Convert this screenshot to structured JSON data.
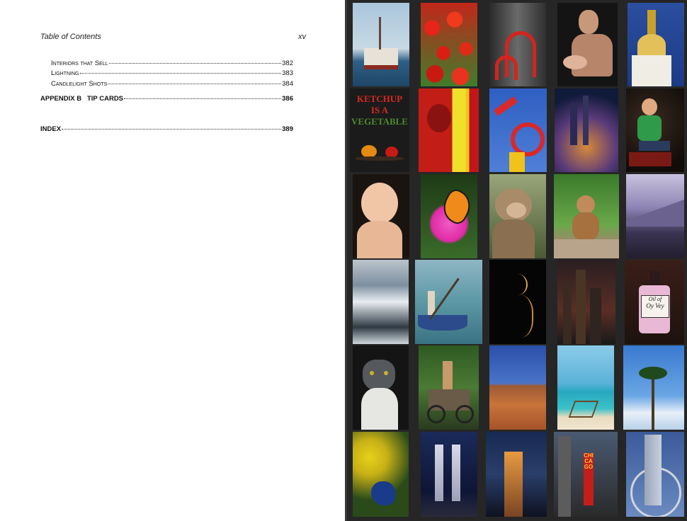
{
  "toc": {
    "header_title": "Table of Contents",
    "header_page": "xv",
    "entries": [
      {
        "label": "Interiors that Sell",
        "page": "382"
      },
      {
        "label": "Lightning",
        "page": "383"
      },
      {
        "label": "Candlelight Shots",
        "page": "384"
      },
      {
        "label": "APPENDIX B   TIP CARDS",
        "page": "386"
      },
      {
        "label": "INDEX",
        "page": "389"
      }
    ]
  },
  "gallery": {
    "ketchup_line1": "KETCHUP",
    "ketchup_line2": "IS A",
    "ketchup_line3": "VEGETABLE",
    "bottle_label_line1": "Oil of",
    "bottle_label_line2": "Oy Vey",
    "sign_text": "CHICAGO",
    "tiles": [
      {
        "subject": "boat-harbor"
      },
      {
        "subject": "red-tulips"
      },
      {
        "subject": "red-sculpture"
      },
      {
        "subject": "father-baby"
      },
      {
        "subject": "stupa-temple"
      },
      {
        "subject": "ketchup-poster"
      },
      {
        "subject": "red-yellow-abstract"
      },
      {
        "subject": "red-crane"
      },
      {
        "subject": "city-night-blur"
      },
      {
        "subject": "boy-sitting"
      },
      {
        "subject": "baby-portrait"
      },
      {
        "subject": "butterfly-flower"
      },
      {
        "subject": "monkey-closeup"
      },
      {
        "subject": "monkey-rock"
      },
      {
        "subject": "mountain-dusk"
      },
      {
        "subject": "glacier-lake"
      },
      {
        "subject": "fisherman-boat"
      },
      {
        "subject": "woman-silhouette"
      },
      {
        "subject": "city-night"
      },
      {
        "subject": "perfume-bottle"
      },
      {
        "subject": "gray-cat"
      },
      {
        "subject": "man-cart"
      },
      {
        "subject": "desert-dunes"
      },
      {
        "subject": "beach-chair"
      },
      {
        "subject": "palm-trees"
      },
      {
        "subject": "peacock-flowers"
      },
      {
        "subject": "twin-towers"
      },
      {
        "subject": "tower-night"
      },
      {
        "subject": "chicago-theatre"
      },
      {
        "subject": "steel-globe"
      }
    ]
  }
}
